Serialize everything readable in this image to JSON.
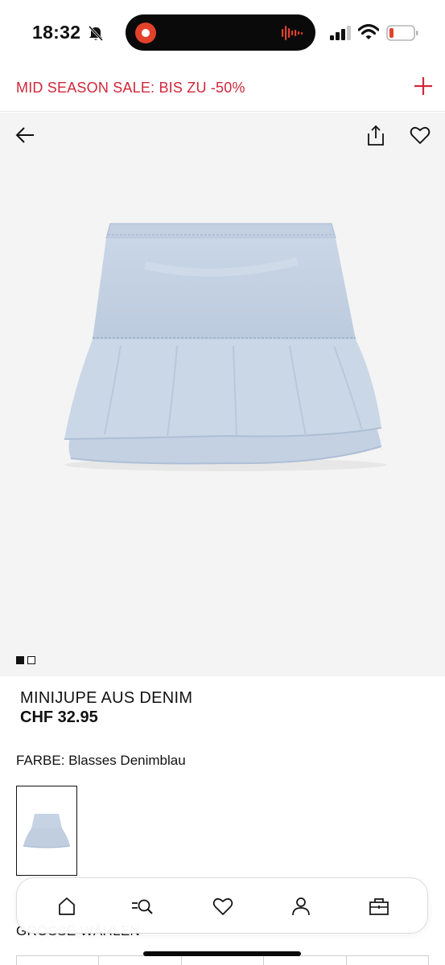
{
  "status_bar": {
    "time": "18:32",
    "icons": [
      "bell-slash-icon",
      "record-icon",
      "waveform-icon",
      "signal-icon",
      "wifi-icon",
      "battery-low-icon"
    ]
  },
  "promo": {
    "text": "MID SEASON SALE: BIS ZU -50%",
    "accent_color": "#d1273a",
    "expand_icon": "plus-icon"
  },
  "gallery": {
    "icons": [
      "back-arrow-icon",
      "share-icon",
      "heart-icon"
    ],
    "image_count": 2,
    "active_index": 0
  },
  "product": {
    "name": "MINIJUPE AUS DENIM",
    "price": "CHF 32.95",
    "color_label": "FARBE: Blasses Denimblau"
  },
  "sizes": {
    "heading": "GRÖSSE WÄHLEN"
  },
  "bottom_nav": {
    "items": [
      "home-icon",
      "search-filter-icon",
      "favorites-icon",
      "account-icon",
      "bag-icon"
    ]
  }
}
